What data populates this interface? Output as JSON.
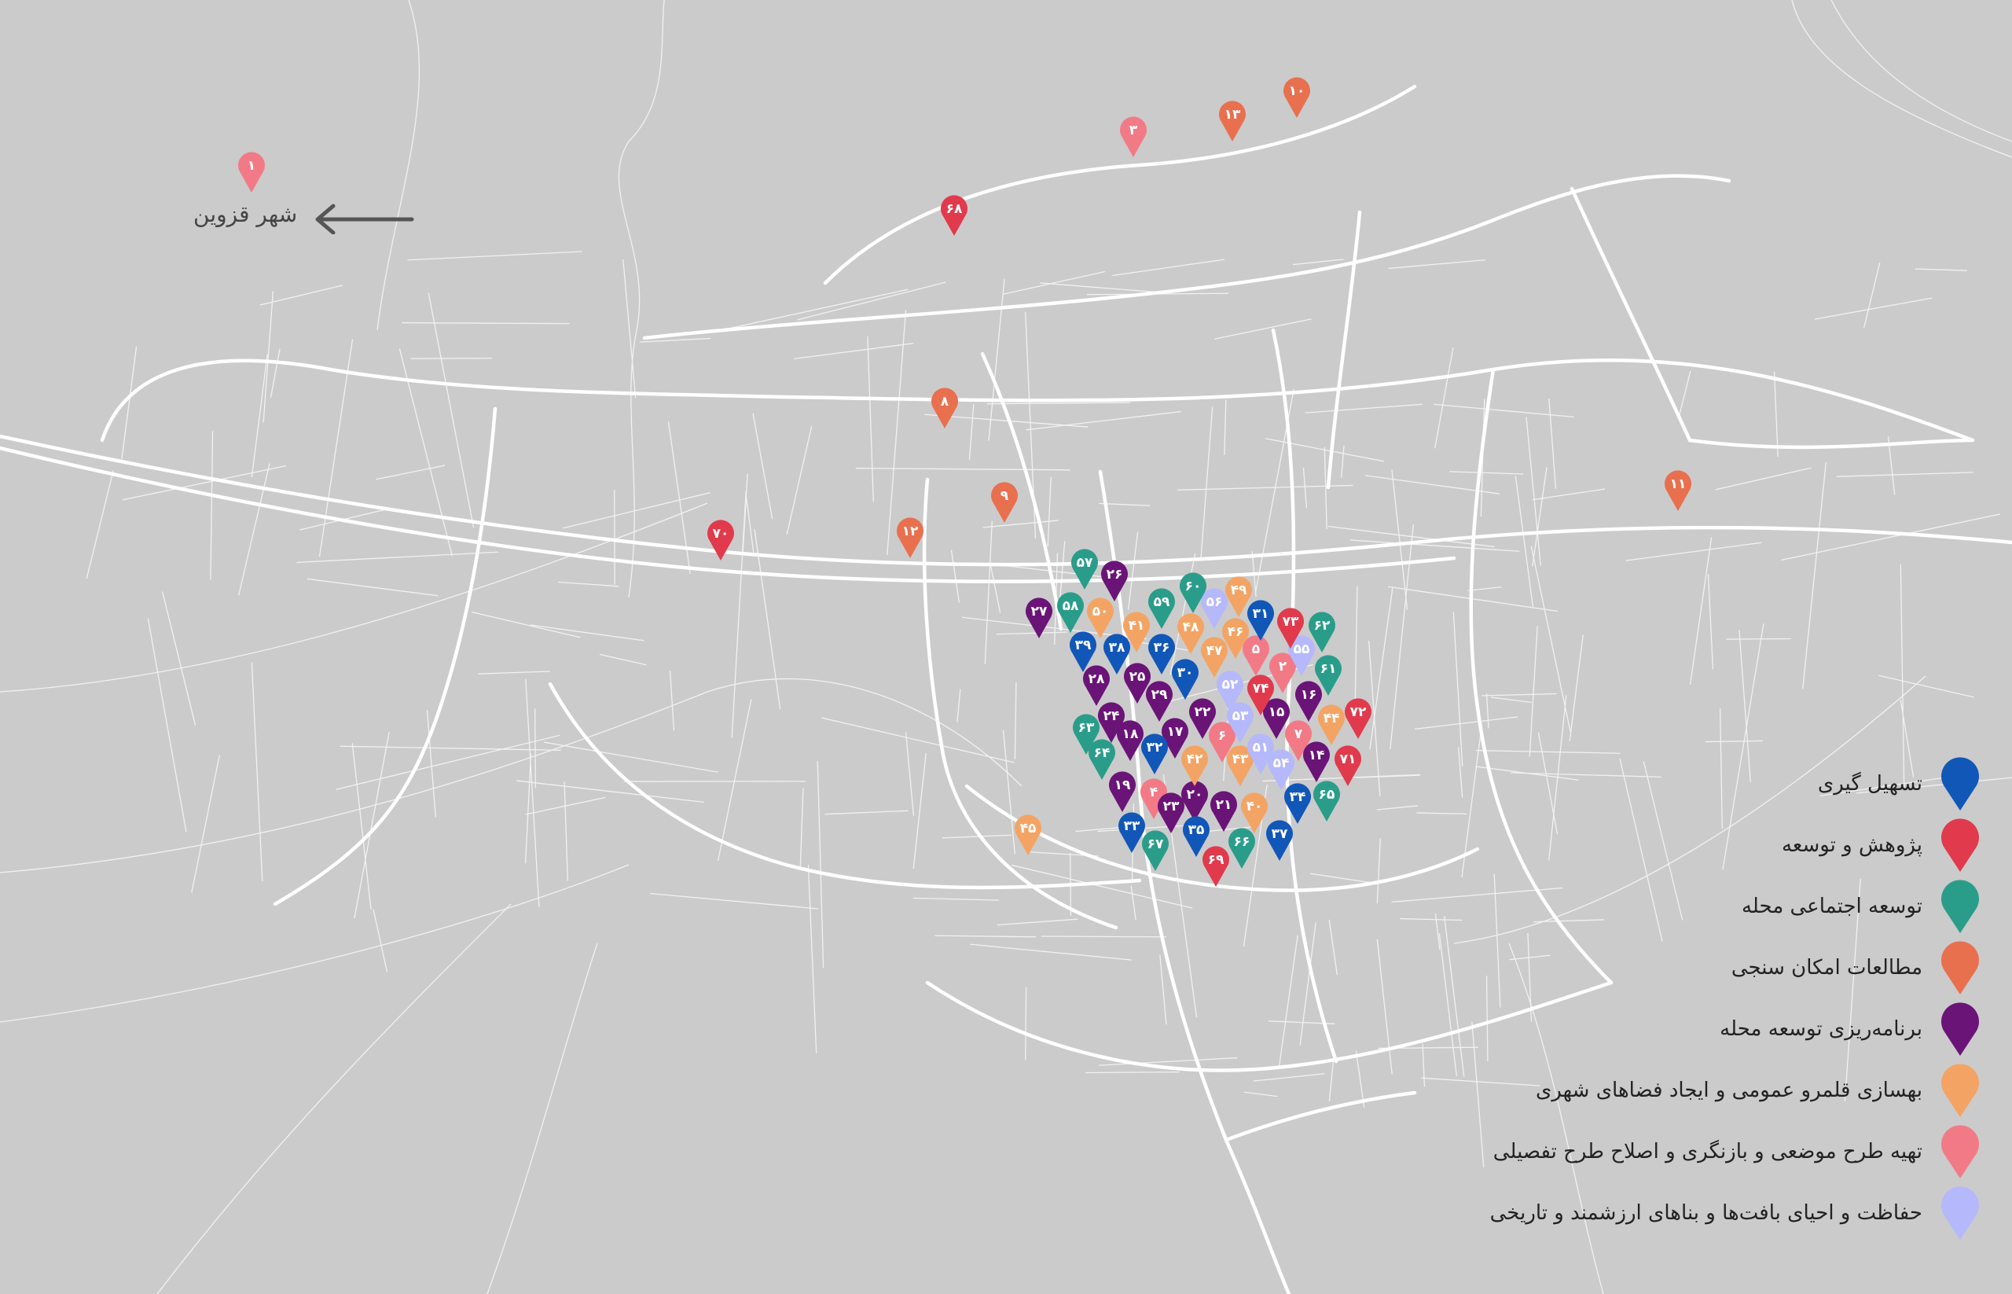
{
  "map": {
    "background_color": "#cbcbcb",
    "road_color": "#ffffff",
    "qazvin_label": "شهر قزوین",
    "qazvin_arrow_icon": "arrow-left-icon"
  },
  "categories": [
    {
      "id": "facilitation",
      "label": "تسهیل گیری",
      "color": "#1157b8"
    },
    {
      "id": "research",
      "label": "پژوهش و توسعه",
      "color": "#e03a4c"
    },
    {
      "id": "social",
      "label": "توسعه اجتماعی محله",
      "color": "#2a9d8a"
    },
    {
      "id": "feasibility",
      "label": "مطالعات امکان سنجی",
      "color": "#e8704f"
    },
    {
      "id": "planning",
      "label": "برنامه‌ریزی توسعه محله",
      "color": "#6a1477"
    },
    {
      "id": "public_realm",
      "label": "بهسازی قلمرو عمومی و ایجاد فضاهای شهری",
      "color": "#f3a464"
    },
    {
      "id": "detailed_plan",
      "label": "تهیه طرح موضعی و بازنگری و اصلاح طرح تفصیلی",
      "color": "#f27a87"
    },
    {
      "id": "heritage",
      "label": "حفاظت و احیای بافت‌ها و بناهای ارزشمند و تاریخی",
      "color": "#b5b8fb"
    }
  ],
  "markers": [
    {
      "label": "۱",
      "category": "detailed_plan"
    },
    {
      "label": "۲",
      "category": "detailed_plan"
    },
    {
      "label": "۳",
      "category": "detailed_plan"
    },
    {
      "label": "۴",
      "category": "detailed_plan"
    },
    {
      "label": "۵",
      "category": "detailed_plan"
    },
    {
      "label": "۶",
      "category": "detailed_plan"
    },
    {
      "label": "۷",
      "category": "detailed_plan"
    },
    {
      "label": "۸",
      "category": "feasibility"
    },
    {
      "label": "۹",
      "category": "feasibility"
    },
    {
      "label": "۱۰",
      "category": "feasibility"
    },
    {
      "label": "۱۱",
      "category": "feasibility"
    },
    {
      "label": "۱۲",
      "category": "feasibility"
    },
    {
      "label": "۱۳",
      "category": "feasibility"
    },
    {
      "label": "۱۴",
      "category": "planning"
    },
    {
      "label": "۱۵",
      "category": "planning"
    },
    {
      "label": "۱۶",
      "category": "planning"
    },
    {
      "label": "۱۷",
      "category": "planning"
    },
    {
      "label": "۱۸",
      "category": "planning"
    },
    {
      "label": "۱۹",
      "category": "planning"
    },
    {
      "label": "۲۰",
      "category": "planning"
    },
    {
      "label": "۲۱",
      "category": "planning"
    },
    {
      "label": "۲۲",
      "category": "planning"
    },
    {
      "label": "۲۳",
      "category": "planning"
    },
    {
      "label": "۲۴",
      "category": "planning"
    },
    {
      "label": "۲۵",
      "category": "planning"
    },
    {
      "label": "۲۶",
      "category": "planning"
    },
    {
      "label": "۲۷",
      "category": "planning"
    },
    {
      "label": "۲۸",
      "category": "planning"
    },
    {
      "label": "۲۹",
      "category": "planning"
    },
    {
      "label": "۳۰",
      "category": "facilitation"
    },
    {
      "label": "۳۱",
      "category": "facilitation"
    },
    {
      "label": "۳۲",
      "category": "facilitation"
    },
    {
      "label": "۳۳",
      "category": "facilitation"
    },
    {
      "label": "۳۴",
      "category": "facilitation"
    },
    {
      "label": "۳۵",
      "category": "facilitation"
    },
    {
      "label": "۳۶",
      "category": "facilitation"
    },
    {
      "label": "۳۷",
      "category": "facilitation"
    },
    {
      "label": "۳۸",
      "category": "facilitation"
    },
    {
      "label": "۳۹",
      "category": "facilitation"
    },
    {
      "label": "۴۰",
      "category": "public_realm"
    },
    {
      "label": "۴۱",
      "category": "public_realm"
    },
    {
      "label": "۴۲",
      "category": "public_realm"
    },
    {
      "label": "۴۳",
      "category": "public_realm"
    },
    {
      "label": "۴۴",
      "category": "public_realm"
    },
    {
      "label": "۴۵",
      "category": "public_realm"
    },
    {
      "label": "۴۶",
      "category": "public_realm"
    },
    {
      "label": "۴۷",
      "category": "public_realm"
    },
    {
      "label": "۴۸",
      "category": "public_realm"
    },
    {
      "label": "۴۹",
      "category": "public_realm"
    },
    {
      "label": "۵۰",
      "category": "public_realm"
    },
    {
      "label": "۵۱",
      "category": "heritage"
    },
    {
      "label": "۵۲",
      "category": "heritage"
    },
    {
      "label": "۵۳",
      "category": "heritage"
    },
    {
      "label": "۵۴",
      "category": "heritage"
    },
    {
      "label": "۵۵",
      "category": "heritage"
    },
    {
      "label": "۵۶",
      "category": "heritage"
    },
    {
      "label": "۵۷",
      "category": "social"
    },
    {
      "label": "۵۸",
      "category": "social"
    },
    {
      "label": "۵۹",
      "category": "social"
    },
    {
      "label": "۶۰",
      "category": "social"
    },
    {
      "label": "۶۱",
      "category": "social"
    },
    {
      "label": "۶۲",
      "category": "social"
    },
    {
      "label": "۶۳",
      "category": "social"
    },
    {
      "label": "۶۴",
      "category": "social"
    },
    {
      "label": "۶۵",
      "category": "social"
    },
    {
      "label": "۶۶",
      "category": "social"
    },
    {
      "label": "۶۷",
      "category": "social"
    },
    {
      "label": "۶۸",
      "category": "research"
    },
    {
      "label": "۶۹",
      "category": "research"
    },
    {
      "label": "۷۰",
      "category": "research"
    },
    {
      "label": "۷۱",
      "category": "research"
    },
    {
      "label": "۷۲",
      "category": "research"
    },
    {
      "label": "۷۳",
      "category": "research"
    },
    {
      "label": "۷۴",
      "category": "research"
    }
  ]
}
